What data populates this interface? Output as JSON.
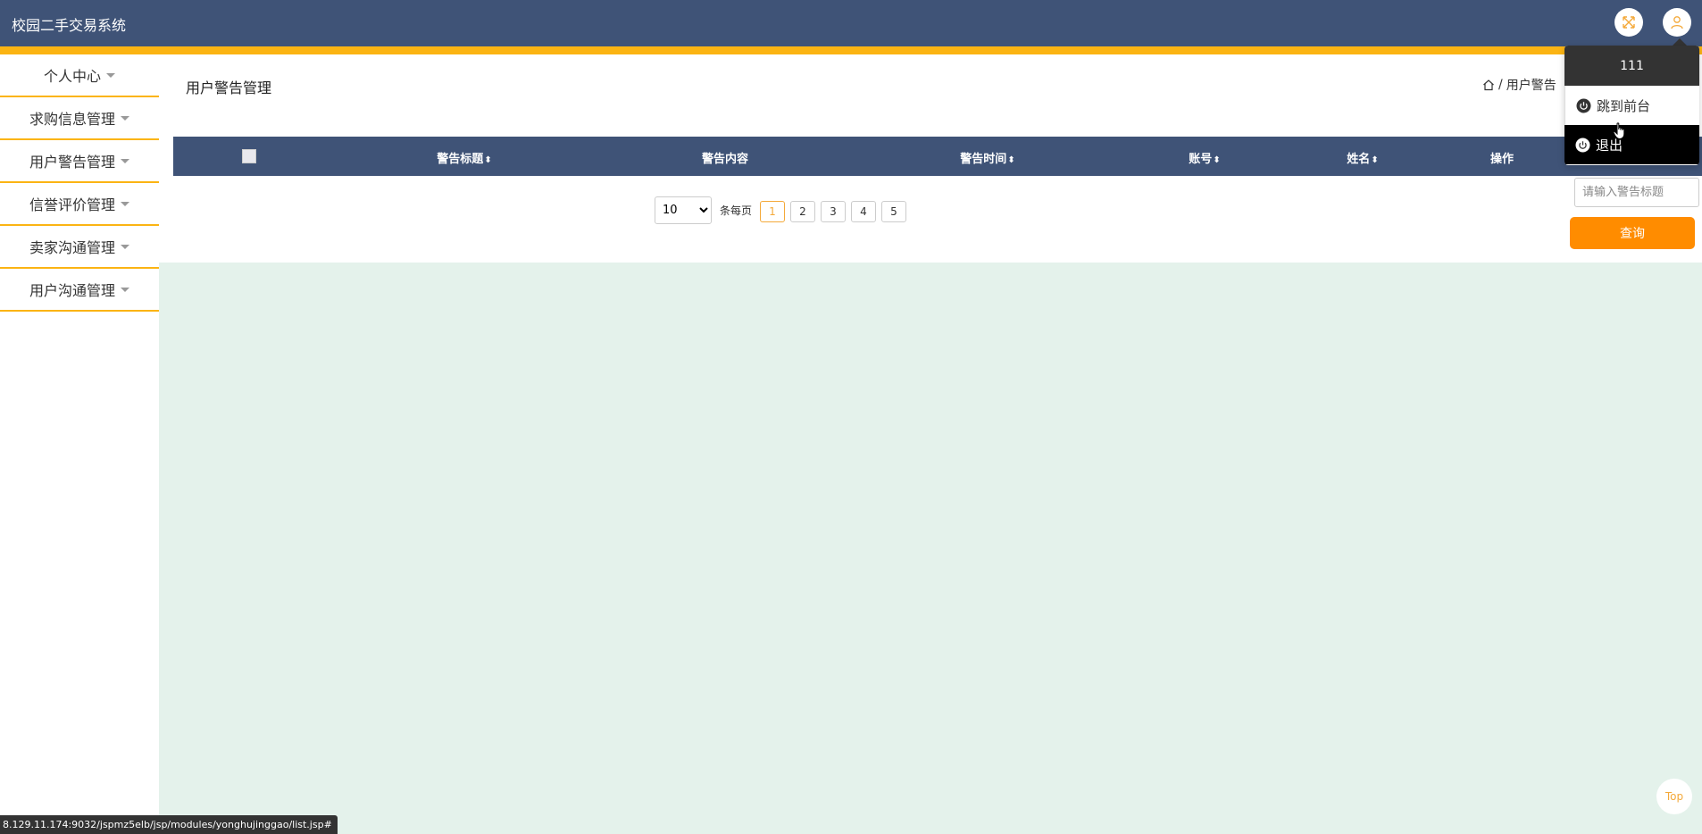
{
  "header": {
    "title": "校园二手交易系统"
  },
  "sidebar": {
    "items": [
      {
        "label": "个人中心"
      },
      {
        "label": "求购信息管理"
      },
      {
        "label": "用户警告管理"
      },
      {
        "label": "信誉评价管理"
      },
      {
        "label": "卖家沟通管理"
      },
      {
        "label": "用户沟通管理"
      }
    ]
  },
  "main": {
    "title": "用户警告管理",
    "breadcrumb": {
      "separator": "/",
      "current": "用户警告"
    },
    "table": {
      "columns": [
        "警告标题",
        "警告内容",
        "警告时间",
        "账号",
        "姓名",
        "操作"
      ]
    },
    "pagination": {
      "page_size": "10",
      "per_page_label": "条每页",
      "pages": [
        "1",
        "2",
        "3",
        "4",
        "5"
      ],
      "current": "1"
    },
    "search": {
      "placeholder": "请输入警告标题",
      "button": "查询"
    }
  },
  "user_menu": {
    "username": "111",
    "items": [
      {
        "label": "跳到前台"
      },
      {
        "label": "退出"
      }
    ]
  },
  "statusbar": {
    "url": "8.129.11.174:9032/jspmz5elb/jsp/modules/yonghujinggao/list.jsp#"
  },
  "top_button": {
    "label": "Top"
  },
  "colors": {
    "header": "#3f5377",
    "accent": "#fbb413",
    "primary_button": "#ff8c00",
    "background": "#e4f2eb"
  }
}
